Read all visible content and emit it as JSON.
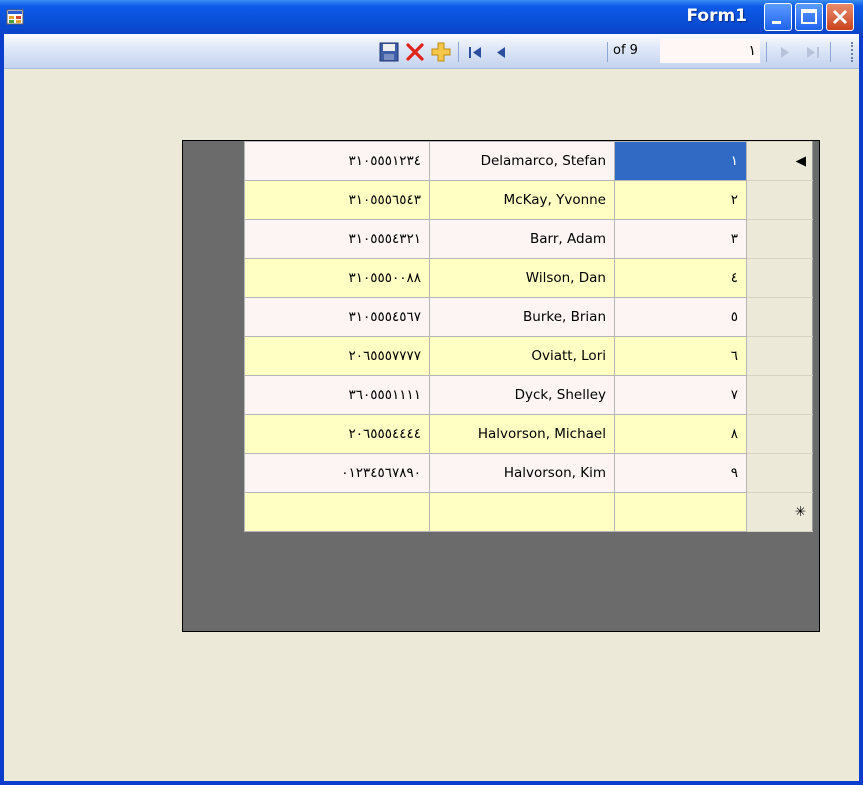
{
  "window": {
    "title": "Form1",
    "icons": {
      "app": "app-icon",
      "minimize": "minimize-icon",
      "maximize": "maximize-icon",
      "close": "close-icon"
    },
    "colors": {
      "titlebar": "#0A4FD8",
      "selection": "#316AC5",
      "row_alt": "#FFFFC4",
      "row": "#FCF5F4"
    }
  },
  "navigator": {
    "tools": [
      "save-icon",
      "delete-icon",
      "add-new-icon",
      "move-first-icon",
      "move-previous-icon",
      "move-next-icon",
      "move-last-icon"
    ],
    "of_label": "of 9",
    "position_value": "١"
  },
  "grid": {
    "current_row_indicator": "◀",
    "new_row_indicator": "✳",
    "rows": [
      {
        "id": "١",
        "name": "Delamarco, Stefan",
        "phone": "٣١٠٥٥٥١٢٣٤"
      },
      {
        "id": "٢",
        "name": "McKay, Yvonne",
        "phone": "٣١٠٥٥٥٦٥٤٣"
      },
      {
        "id": "٣",
        "name": "Barr, Adam",
        "phone": "٣١٠٥٥٥٤٣٢١"
      },
      {
        "id": "٤",
        "name": "Wilson, Dan",
        "phone": "٣١٠٥٥٥٠٠٨٨"
      },
      {
        "id": "٥",
        "name": "Burke, Brian",
        "phone": "٣١٠٥٥٥٤٥٦٧"
      },
      {
        "id": "٦",
        "name": "Oviatt, Lori",
        "phone": "٢٠٦٥٥٥٧٧٧٧"
      },
      {
        "id": "٧",
        "name": "Dyck, Shelley",
        "phone": "٣٦٠٥٥٥١١١١"
      },
      {
        "id": "٨",
        "name": "Halvorson, Michael",
        "phone": "٢٠٦٥٥٥٤٤٤٤"
      },
      {
        "id": "٩",
        "name": "Halvorson, Kim",
        "phone": "٠١٢٣٤٥٦٧٨٩٠"
      }
    ]
  }
}
